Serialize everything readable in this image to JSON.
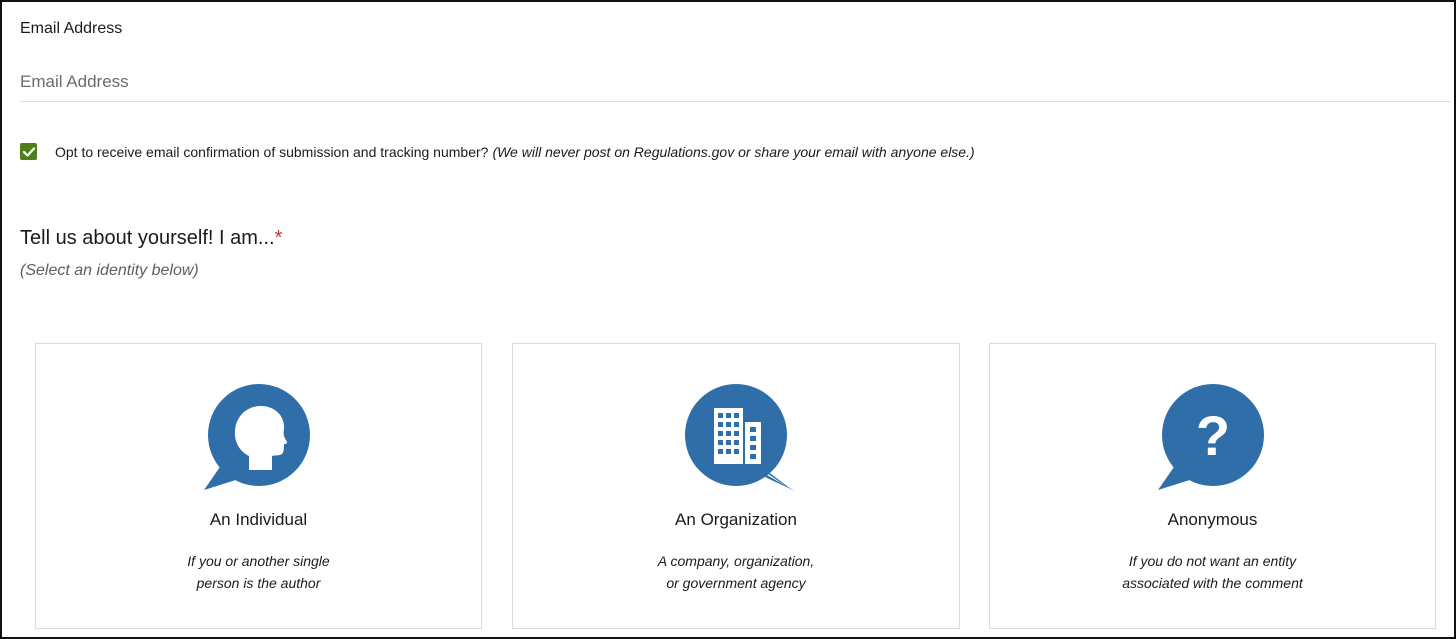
{
  "email": {
    "label": "Email Address",
    "placeholder": "Email Address"
  },
  "opt_in": {
    "checked": true,
    "text": "Opt to receive email confirmation of submission and tracking number?",
    "note": "(We will never post on Regulations.gov or share your email with anyone else.)"
  },
  "identity": {
    "heading": "Tell us about yourself! I am...",
    "required_mark": "*",
    "subheading": "(Select an identity below)",
    "cards": [
      {
        "icon": "person-head-icon",
        "title": "An Individual",
        "desc_line1": "If you or another single",
        "desc_line2": "person is the author"
      },
      {
        "icon": "building-icon",
        "title": "An Organization",
        "desc_line1": "A company, organization,",
        "desc_line2": "or government agency"
      },
      {
        "icon": "question-mark-icon",
        "title": "Anonymous",
        "desc_line1": "If you do not want an entity",
        "desc_line2": "associated with the comment"
      }
    ]
  },
  "colors": {
    "icon_blue": "#2f6ea8",
    "checkbox_green": "#4e7d1c",
    "required_red": "#c0392b"
  }
}
